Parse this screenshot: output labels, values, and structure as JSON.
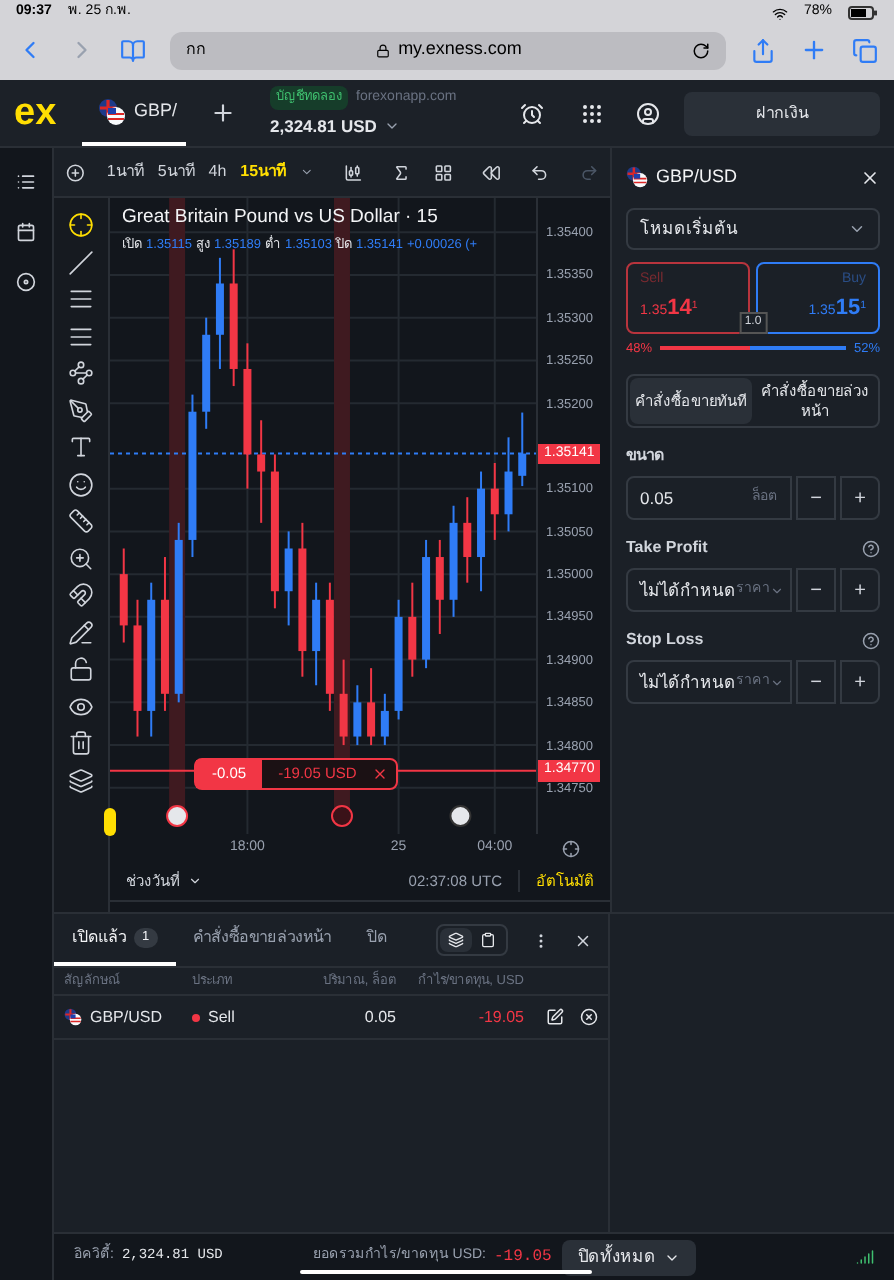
{
  "status_bar": {
    "time": "09:37",
    "date": "พ. 25 ก.พ.",
    "battery": "78%"
  },
  "browser": {
    "text_size": "กก",
    "url": "my.exness.com"
  },
  "header": {
    "logo": "ex",
    "tab": "GBP/",
    "account_badge": "บัญชีทดลอง",
    "server": "forexonapp.com",
    "balance": "2,324.81 USD",
    "deposit": "ฝากเงิน"
  },
  "toolbar": {
    "timeframes": [
      {
        "label": "1นาที",
        "selected": false
      },
      {
        "label": "5นาที",
        "selected": false
      },
      {
        "label": "4h",
        "selected": false
      },
      {
        "label": "15นาที",
        "selected": true
      }
    ]
  },
  "chart": {
    "title": "Great Britain Pound vs US Dollar · 15",
    "ohlc": [
      {
        "label": "เปิด",
        "value": "1.35115"
      },
      {
        "label": "สูง",
        "value": "1.35189"
      },
      {
        "label": "ต่ำ",
        "value": "1.35103"
      },
      {
        "label": "ปิด",
        "value": "1.35141"
      }
    ],
    "change": "+0.00026 (+",
    "chart_data": {
      "type": "candlestick",
      "categories": [
        null,
        null,
        null,
        null,
        null,
        null,
        null,
        null,
        null,
        "18:00",
        null,
        null,
        null,
        null,
        null,
        null,
        null,
        null,
        null,
        null,
        "25",
        null,
        null,
        null,
        null,
        null,
        null,
        "04:00",
        null,
        null
      ],
      "ohlc": [
        [
          1.35,
          1.3503,
          1.3492,
          1.3494
        ],
        [
          1.3494,
          1.3497,
          1.3481,
          1.3484
        ],
        [
          1.3484,
          1.3499,
          1.3481,
          1.3497
        ],
        [
          1.3497,
          1.3502,
          1.3484,
          1.3486
        ],
        [
          1.3486,
          1.3506,
          1.3485,
          1.3504
        ],
        [
          1.3504,
          1.3521,
          1.3502,
          1.3519
        ],
        [
          1.3519,
          1.353,
          1.3517,
          1.3528
        ],
        [
          1.3528,
          1.3537,
          1.3524,
          1.3534
        ],
        [
          1.3534,
          1.3538,
          1.3522,
          1.3524
        ],
        [
          1.3524,
          1.3527,
          1.351,
          1.3514
        ],
        [
          1.3514,
          1.3518,
          1.3506,
          1.3512
        ],
        [
          1.3512,
          1.3514,
          1.3496,
          1.3498
        ],
        [
          1.3498,
          1.3505,
          1.3494,
          1.3503
        ],
        [
          1.3503,
          1.3506,
          1.3488,
          1.3491
        ],
        [
          1.3491,
          1.3499,
          1.3487,
          1.3497
        ],
        [
          1.3497,
          1.3499,
          1.3484,
          1.3486
        ],
        [
          1.3486,
          1.349,
          1.348,
          1.3481
        ],
        [
          1.3481,
          1.3487,
          1.348,
          1.3485
        ],
        [
          1.3485,
          1.3489,
          1.348,
          1.3481
        ],
        [
          1.3481,
          1.3486,
          1.348,
          1.3484
        ],
        [
          1.3484,
          1.3497,
          1.3483,
          1.3495
        ],
        [
          1.3495,
          1.3499,
          1.3488,
          1.349
        ],
        [
          1.349,
          1.3504,
          1.3489,
          1.3502
        ],
        [
          1.3502,
          1.3504,
          1.3493,
          1.3497
        ],
        [
          1.3497,
          1.3508,
          1.3495,
          1.3506
        ],
        [
          1.3506,
          1.3509,
          1.3499,
          1.3502
        ],
        [
          1.3502,
          1.3512,
          1.3498,
          1.351
        ],
        [
          1.351,
          1.3513,
          1.3504,
          1.3507
        ],
        [
          1.3507,
          1.3516,
          1.3505,
          1.3512
        ],
        [
          1.35115,
          1.35189,
          1.35103,
          1.35141
        ]
      ],
      "ylim": [
        1.34696,
        1.3544
      ],
      "grid": true,
      "ref_lines": [
        {
          "axis": "y",
          "value": 1.3477,
          "label": "1.34770",
          "color": "#f23645"
        },
        {
          "axis": "y",
          "value": 1.35141,
          "label": "1.35141",
          "color": "#2f7cf6"
        }
      ],
      "yticks": [
        {
          "value": 1.354,
          "label": "1.35400"
        },
        {
          "value": 1.3535,
          "label": "1.35350"
        },
        {
          "value": 1.353,
          "label": "1.35300"
        },
        {
          "value": 1.3525,
          "label": "1.35250"
        },
        {
          "value": 1.352,
          "label": "1.35200"
        },
        {
          "value": 1.351,
          "label": "1.35100"
        },
        {
          "value": 1.3505,
          "label": "1.35050"
        },
        {
          "value": 1.35,
          "label": "1.35000"
        },
        {
          "value": 1.3495,
          "label": "1.34950"
        },
        {
          "value": 1.349,
          "label": "1.34900"
        },
        {
          "value": 1.3485,
          "label": "1.34850"
        },
        {
          "value": 1.348,
          "label": "1.34800"
        },
        {
          "value": 1.3475,
          "label": "1.34750"
        }
      ]
    },
    "position": {
      "volume": "-0.05",
      "pnl": "-19.05 USD"
    },
    "range": "ช่วงวันที่",
    "clock": "02:37:08 UTC",
    "scale_mode": "อัตโนมัติ"
  },
  "order_panel": {
    "symbol": "GBP/USD",
    "mode": "โหมดเริ่มต้น",
    "sell": {
      "label": "Sell",
      "price_small": "1.35",
      "price_big": "14",
      "price_sup": "1"
    },
    "buy": {
      "label": "Buy",
      "price_small": "1.35",
      "price_big": "15",
      "price_sup": "1"
    },
    "spread": "1.0",
    "sell_pct": "48%",
    "buy_pct": "52%",
    "level": 0.48,
    "order_types": [
      {
        "label": "คำสั่งซื้อขายทันที",
        "selected": true
      },
      {
        "label": "คำสั่งซื้อขายล่วงหน้า",
        "selected": false
      }
    ],
    "volume": {
      "label": "ขนาด",
      "value": "0.05",
      "unit": "ล็อต",
      "minus": "−",
      "plus": "+"
    },
    "take_profit": {
      "label": "Take Profit",
      "value": "ไม่ได้กำหนด",
      "unit": "ราคา",
      "minus": "−",
      "plus": "+"
    },
    "stop_loss": {
      "label": "Stop Loss",
      "value": "ไม่ได้กำหนด",
      "unit": "ราคา",
      "minus": "−",
      "plus": "+"
    }
  },
  "positions": {
    "tabs": [
      {
        "label": "เปิดแล้ว",
        "count": "1",
        "selected": true
      },
      {
        "label": "คำสั่งซื้อขายล่วงหน้า",
        "selected": false
      },
      {
        "label": "ปิด",
        "selected": false
      }
    ],
    "view_modes": [
      {
        "selected": true
      },
      {
        "selected": false
      }
    ],
    "columns": [
      "สัญลักษณ์",
      "ประเภท",
      "ปริมาณ, ล็อต",
      "กำไร/ขาดทุน, USD"
    ],
    "rows": [
      {
        "symbol": "GBP/USD",
        "type": "Sell",
        "color": "#f23645",
        "volume": "0.05",
        "pnl": "-19.05"
      }
    ]
  },
  "footer": {
    "equity_label": "อิควิตี้:",
    "equity": "2,324.81 USD",
    "total_label": "ยอดรวมกำไร/ขาดทุน USD:",
    "total": "-19.05",
    "close_all": "ปิดทั้งหมด"
  }
}
